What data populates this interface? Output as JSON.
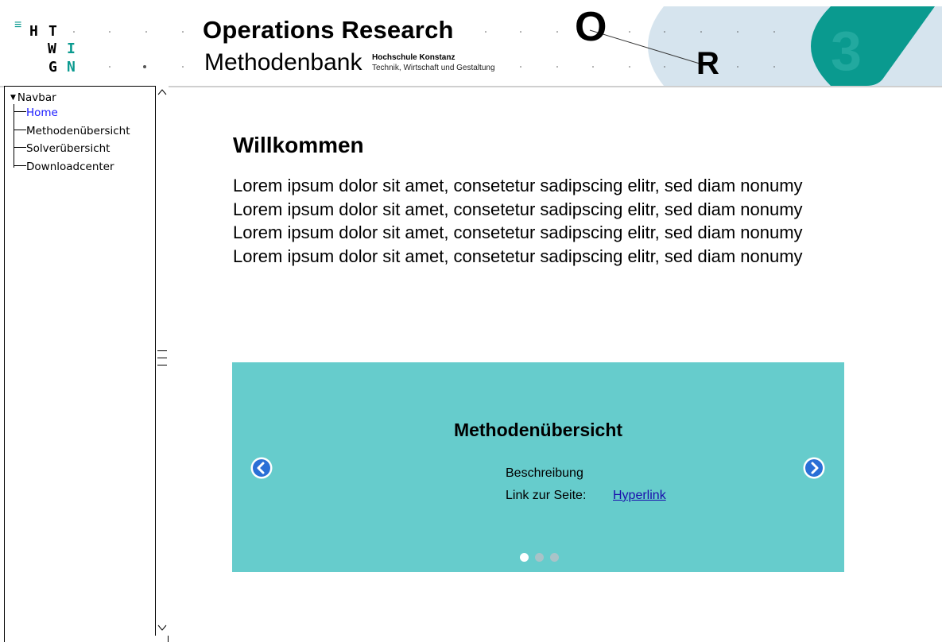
{
  "header": {
    "menu_icon": "≡",
    "logo_letters": [
      "H",
      "T",
      "W",
      "I",
      "G",
      "N"
    ],
    "title": "Operations Research",
    "subtitle": "Methodenbank",
    "institution": "Hochschule Konstanz",
    "faculty": "Technik, Wirtschaft und Gestaltung",
    "or_o": "O",
    "or_r": "R",
    "badge_number": "3",
    "colors": {
      "teal": "#0a9a8f",
      "light_blue": "#d6e4ee"
    }
  },
  "sidebar": {
    "root_label": "Navbar",
    "items": [
      {
        "label": "Home",
        "active": true
      },
      {
        "label": "Methodenübersicht",
        "active": false
      },
      {
        "label": "Solverübersicht",
        "active": false
      },
      {
        "label": "Downloadcenter",
        "active": false
      }
    ],
    "scroll_up_glyph": "^",
    "scroll_down_glyph": "v"
  },
  "main": {
    "heading": "Willkommen",
    "paragraph_lines": [
      "Lorem ipsum dolor sit amet, consetetur sadipscing elitr, sed diam nonumy",
      "Lorem ipsum dolor sit amet, consetetur sadipscing elitr, sed diam nonumy",
      "Lorem ipsum dolor sit amet, consetetur sadipscing elitr, sed diam nonumy",
      "Lorem ipsum dolor sit amet, consetetur sadipscing elitr, sed diam nonumy"
    ]
  },
  "carousel": {
    "slide_title": "Methodenübersicht",
    "description_label": "Beschreibung",
    "link_label": "Link zur Seite:",
    "link_text": "Hyperlink",
    "active_slide": 1,
    "slide_count": 3,
    "background": "#66cccc",
    "arrow_color": "#2a6fd6"
  }
}
